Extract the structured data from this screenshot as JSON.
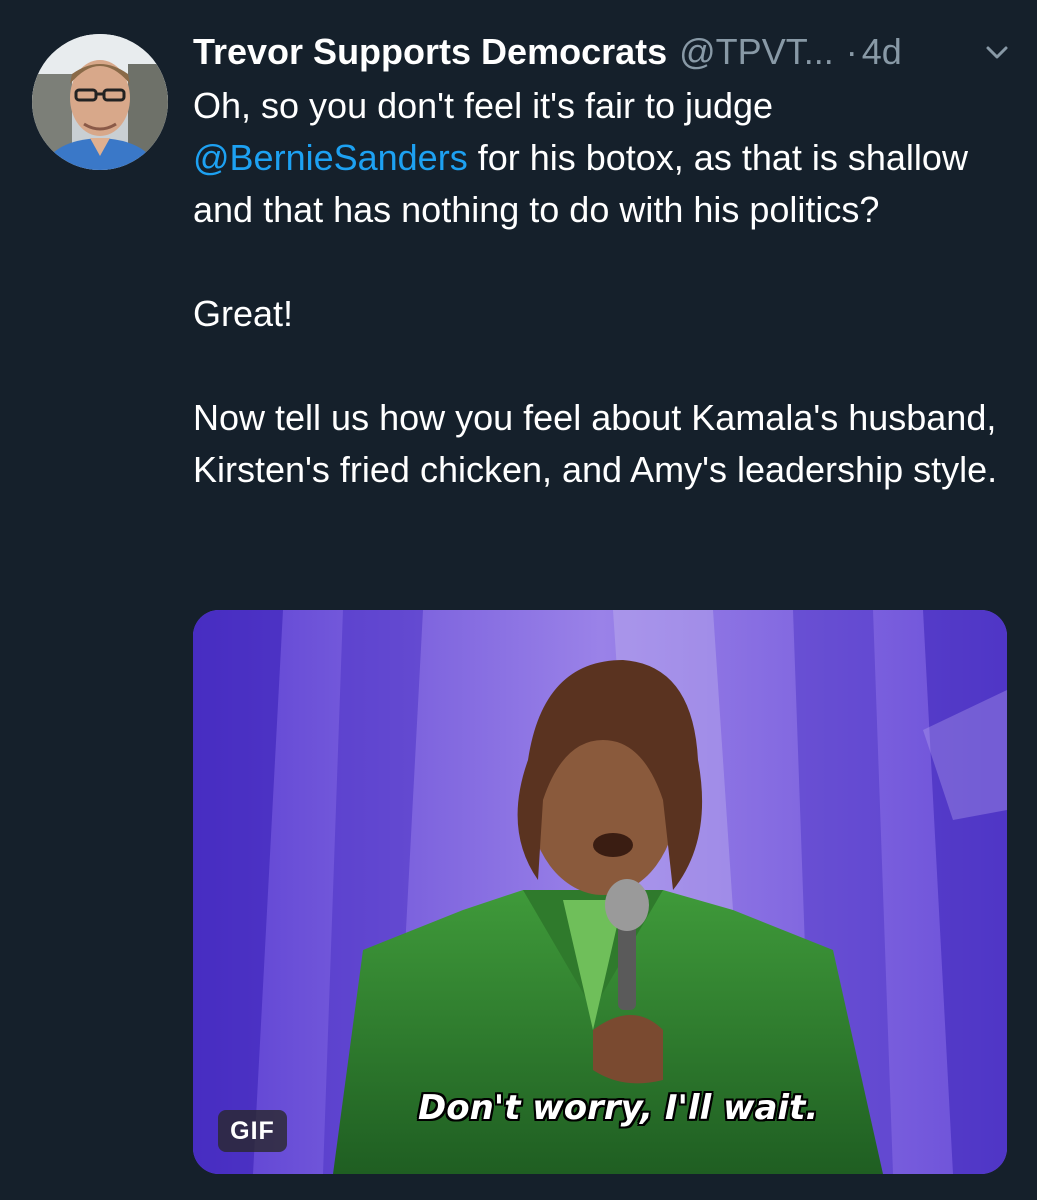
{
  "tweet": {
    "display_name": "Trevor Supports Democrats",
    "handle": "@TPVT...",
    "separator": "·",
    "time": "4d",
    "body": {
      "line1_pre": "Oh, so you don't feel it's fair to judge ",
      "mention": "@BernieSanders",
      "line1_post": " for his botox, as that is shallow and that has nothing to do with his politics?",
      "paragraph2": "Great!",
      "paragraph3": "Now tell us how you feel about Kamala's husband, Kirsten's fried chicken, and Amy's leadership style."
    },
    "media": {
      "badge": "GIF",
      "caption": "Don't worry, I'll wait."
    },
    "icons": {
      "avatar": "avatar-photo",
      "caret": "chevron-down-icon"
    },
    "colors": {
      "background": "#15202b",
      "text": "#ffffff",
      "secondary": "#8899a6",
      "link": "#1da1f2"
    }
  }
}
